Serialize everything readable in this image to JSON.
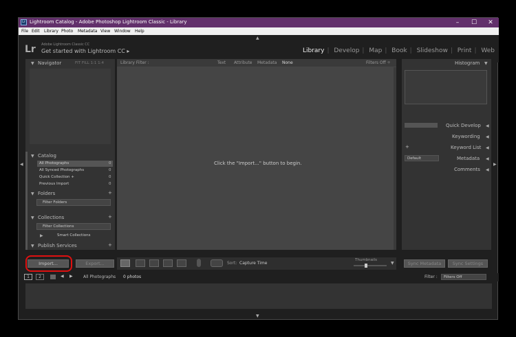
{
  "window": {
    "title": "Lightroom Catalog - Adobe Photoshop Lightroom Classic - Library",
    "app_icon": "Lr",
    "minimize": "–",
    "maximize": "☐",
    "close": "✕"
  },
  "menu": [
    "File",
    "Edit",
    "Library",
    "Photo",
    "Metadata",
    "View",
    "Window",
    "Help"
  ],
  "identity": {
    "logo": "Lr",
    "product": "Adobe Lightroom Classic CC",
    "tagline": "Get started with Lightroom CC",
    "arrow": "▸"
  },
  "modules": [
    "Library",
    "Develop",
    "Map",
    "Book",
    "Slideshow",
    "Print",
    "Web"
  ],
  "active_module": "Library",
  "left_panel": {
    "navigator": "Navigator",
    "nav_zoom": "FIT   FILL   1:1   1:4",
    "catalog": {
      "header": "Catalog",
      "items": [
        {
          "label": "All Photographs",
          "count": "0"
        },
        {
          "label": "All Synced Photographs",
          "count": "0"
        },
        {
          "label": "Quick Collection  +",
          "count": "0"
        },
        {
          "label": "Previous Import",
          "count": "0"
        }
      ]
    },
    "folders": {
      "header": "Folders",
      "filter": "Filter Folders"
    },
    "collections": {
      "header": "Collections",
      "filter": "Filter Collections",
      "smart": "Smart Collections"
    },
    "publish": {
      "header": "Publish Services"
    },
    "plus": "+",
    "import_label": "Import...",
    "export_label": "Export..."
  },
  "library_filter": {
    "title": "Library Filter :",
    "options": [
      "Text",
      "Attribute",
      "Metadata",
      "None"
    ],
    "filters_off": "Filters Off ÷"
  },
  "center_message": "Click the \"Import...\" button to begin.",
  "toolbar": {
    "sort_label": "Sort:",
    "sort_value": "Capture Time",
    "thumbnails": "Thumbnails"
  },
  "right_panel": {
    "histogram": "Histogram",
    "quick_develop": "Quick Develop",
    "keywording": "Keywording",
    "keyword_list": "Keyword List",
    "metadata": "Metadata",
    "metadata_preset": "Default",
    "comments": "Comments",
    "plus": "+",
    "sync_metadata": "Sync Metadata",
    "sync_settings": "Sync Settings"
  },
  "filmstrip_bar": {
    "page1": "1",
    "page2": "2",
    "source": "All Photographs",
    "count": "0 photos",
    "filter_label": "Filter :",
    "filter_value": "Filters Off"
  },
  "colors": {
    "titlebar": "#62306b",
    "highlight_ring": "#e01010",
    "panel_bg": "#333333",
    "center_bg": "#454545"
  }
}
